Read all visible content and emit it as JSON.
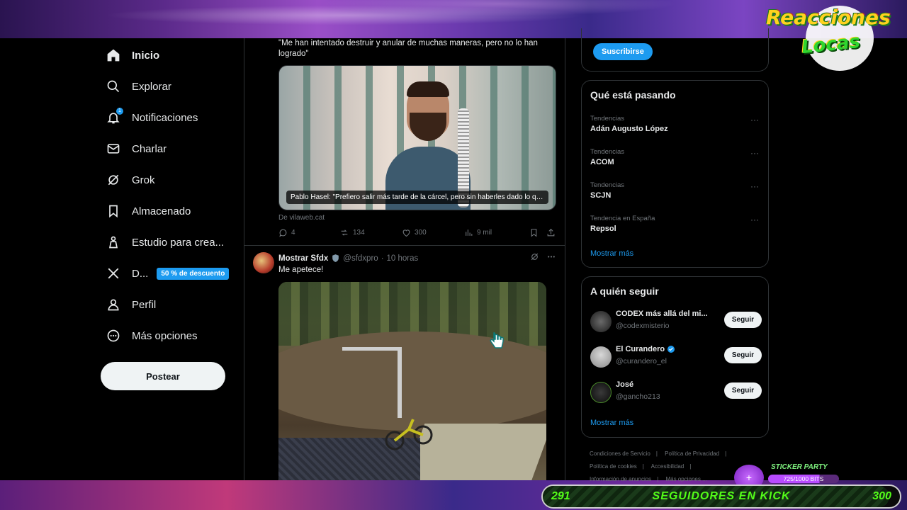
{
  "overlay": {
    "logo_line1": "Reacciones",
    "logo_line2": "Locas",
    "sticker_title": "STICKER PARTY",
    "sticker_progress": "725/1000 BITS",
    "sticker_fraction": 0.725,
    "kick_left": "291",
    "kick_label": "SEGUIDORES EN KICK",
    "kick_right": "300"
  },
  "nav": {
    "items": [
      {
        "label": "Inicio",
        "icon": "home-icon"
      },
      {
        "label": "Explorar",
        "icon": "search-icon"
      },
      {
        "label": "Notificaciones",
        "icon": "bell-icon",
        "badge": "1"
      },
      {
        "label": "Charlar",
        "icon": "mail-icon"
      },
      {
        "label": "Grok",
        "icon": "grok-icon"
      },
      {
        "label": "Almacenado",
        "icon": "bookmark-icon"
      },
      {
        "label": "Estudio para crea...",
        "icon": "creator-studio-icon"
      },
      {
        "label": "D...",
        "icon": "x-logo-icon",
        "promo": "50 % de descuento"
      },
      {
        "label": "Perfil",
        "icon": "person-icon"
      },
      {
        "label": "Más opciones",
        "icon": "more-circle-icon"
      }
    ],
    "post_button": "Postear"
  },
  "tweet1": {
    "text": "\"Me han intentado destruir y anular de muchas maneras, pero no lo han logrado\"",
    "media_caption": "Pablo Hasel: \"Prefiero salir más tarde de la cárcel, pero sin haberles dado lo que ...",
    "source": "De  vilaweb.cat",
    "replies": "4",
    "retweets": "134",
    "likes": "300",
    "views": "9 mil"
  },
  "tweet2": {
    "name": "Mostrar Sfdx",
    "handle": "@sfdxpro",
    "separator": "·",
    "time": "10 horas",
    "text": "Me apetece!"
  },
  "sidebar": {
    "subscribe_button": "Suscribirse",
    "trends_title": "Qué está pasando",
    "trends": [
      {
        "category": "Tendencias",
        "topic": "Adán Augusto López"
      },
      {
        "category": "Tendencias",
        "topic": "ACOM"
      },
      {
        "category": "Tendencias",
        "topic": "SCJN"
      },
      {
        "category": "Tendencia en España",
        "topic": "Repsol"
      }
    ],
    "trends_more": "Mostrar más",
    "follow_title": "A quién seguir",
    "follow": [
      {
        "name": "CODEX más allá del mi...",
        "handle": "@codexmisterio",
        "button": "Seguir"
      },
      {
        "name": "El Curandero",
        "handle": "@curandero_el",
        "button": "Seguir",
        "verified": true
      },
      {
        "name": "José",
        "handle": "@gancho213",
        "button": "Seguir"
      }
    ],
    "follow_more": "Mostrar más",
    "footer": [
      "Condiciones de Servicio",
      "|",
      "Política de Privacidad",
      "|",
      "Política de cookies",
      "|",
      "Accesibilidad",
      "|",
      "Información de anuncios",
      "|",
      "Más opciones ..."
    ]
  },
  "colors": {
    "accent": "#1d9bf0",
    "background": "#000000",
    "kick_green": "#53fc18"
  }
}
